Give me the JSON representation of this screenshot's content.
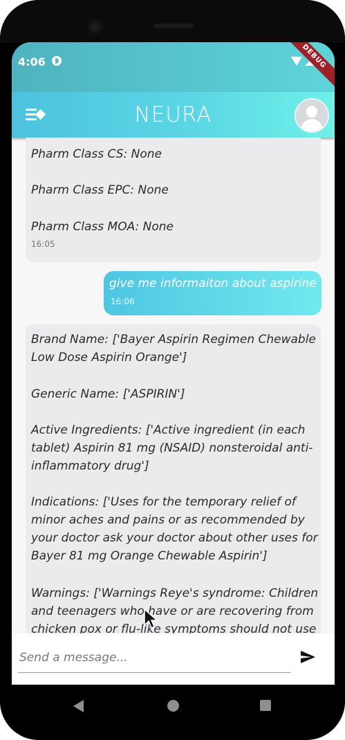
{
  "status_bar": {
    "time": "4:06",
    "debug_label": "DEBUG"
  },
  "app_bar": {
    "title": "NEURA"
  },
  "messages": [
    {
      "direction": "in",
      "lines": [
        "Pharm Class CS: None",
        "",
        "Pharm Class EPC: None",
        "",
        "Pharm Class MOA: None"
      ],
      "time": "16:05"
    },
    {
      "direction": "out",
      "text": "give me informaiton about aspirine",
      "time": "16:06"
    },
    {
      "direction": "in",
      "lines": [
        "Brand Name: ['Bayer Aspirin Regimen Chewable",
        "Low Dose Aspirin Orange']",
        "",
        "Generic Name: ['ASPIRIN']",
        "",
        "Active Ingredients: ['Active ingredient (in each",
        "tablet) Aspirin 81 mg (NSAID) nonsteroidal anti-",
        "inflammatory drug']",
        "",
        "Indications: ['Uses for the temporary relief of",
        "minor aches and pains or as recommended by",
        "your doctor ask your doctor about other uses for",
        "Bayer 81 mg Orange Chewable Aspirin']",
        "",
        "Warnings: ['Warnings Reye's syndrome: Children",
        "and teenagers who have or are recovering from",
        "chicken pox or flu-like symptoms should not use"
      ]
    }
  ],
  "composer": {
    "placeholder": "Send a message..."
  },
  "colors": {
    "accent": "#4dc2de",
    "bubble_in": "#ebebed"
  }
}
